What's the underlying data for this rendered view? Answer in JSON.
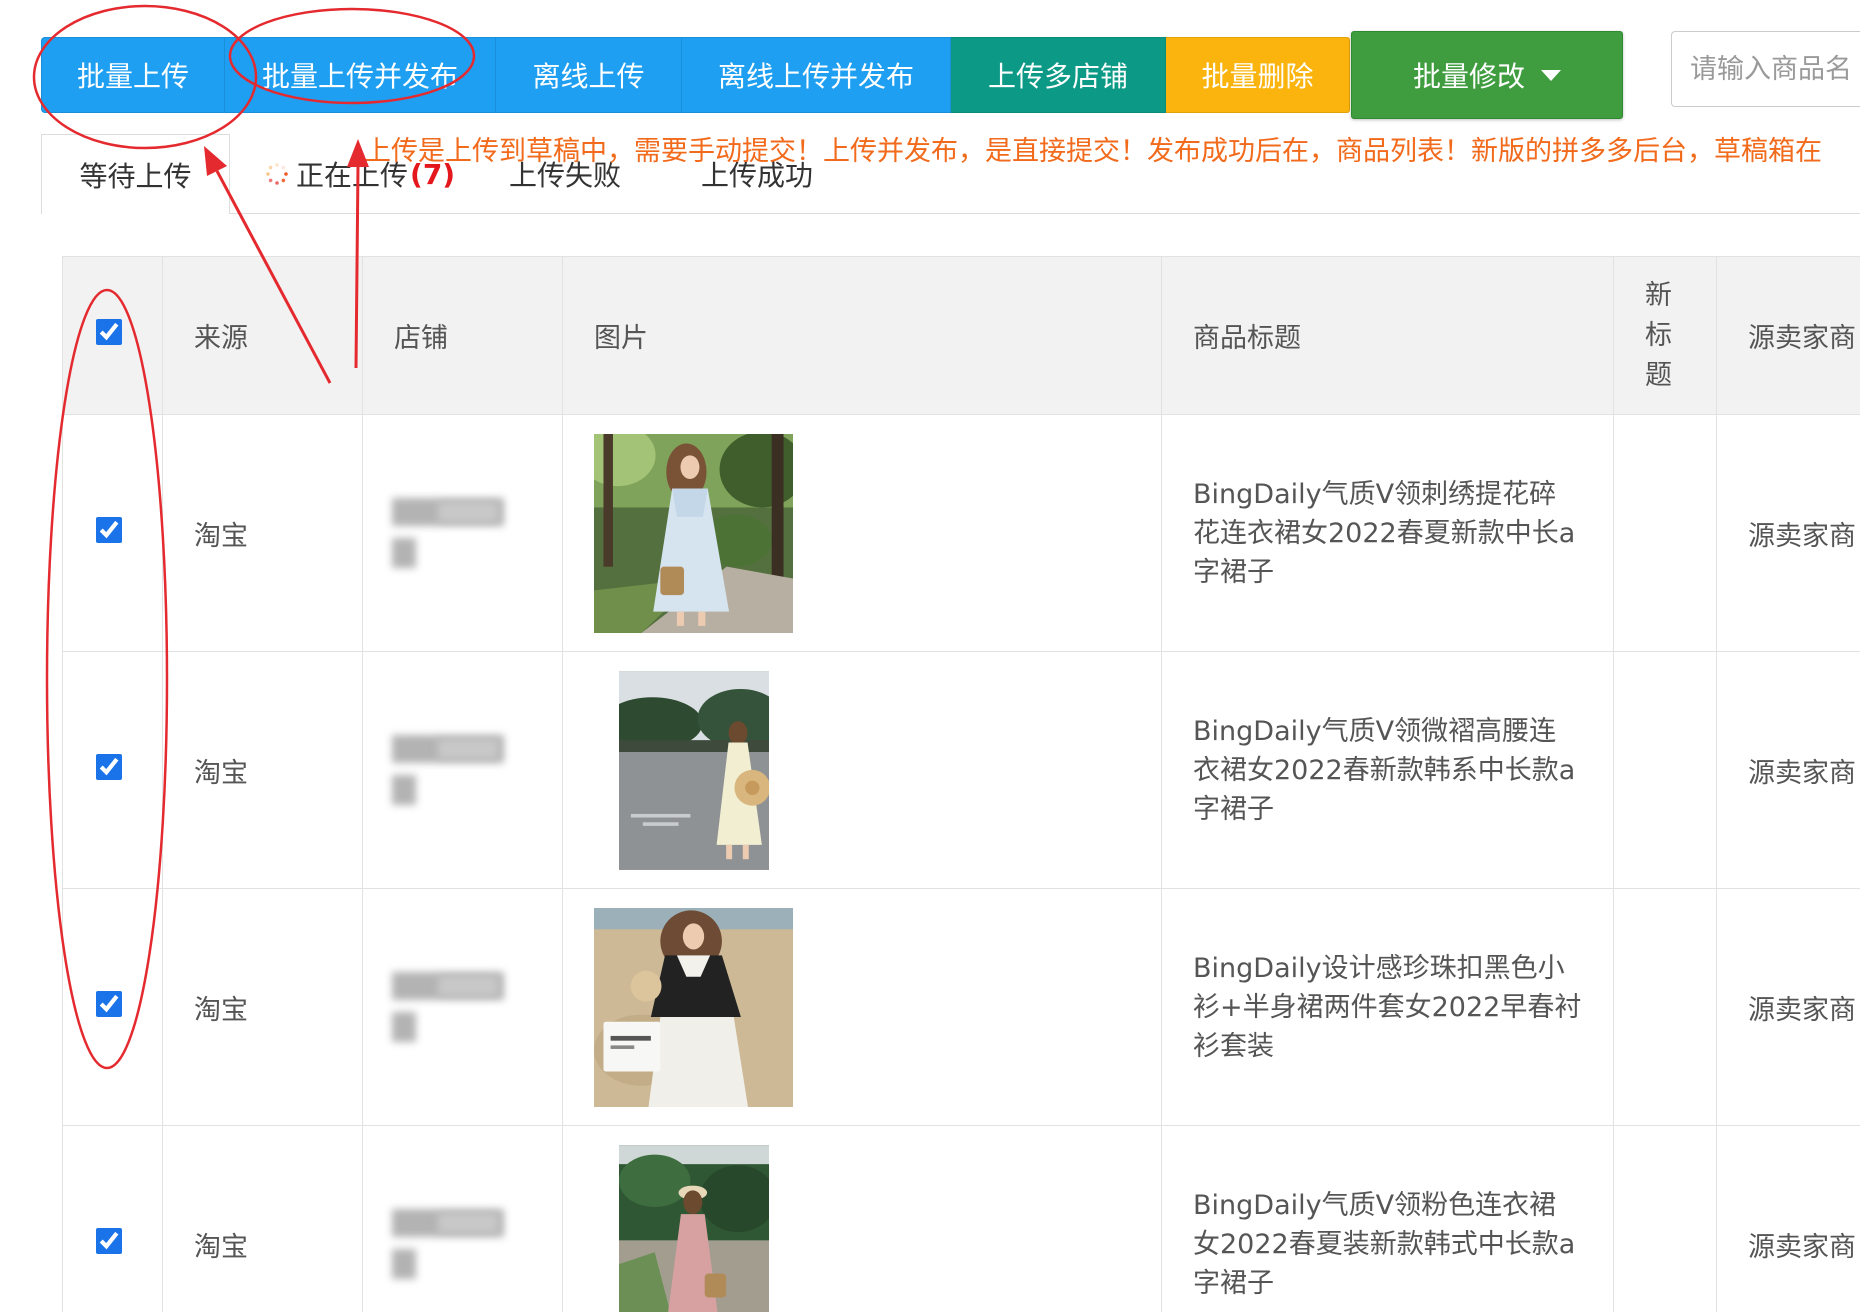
{
  "toolbar": {
    "buttons": [
      {
        "label": "批量上传",
        "color": "#1e9ff2"
      },
      {
        "label": "批量上传并发布",
        "color": "#1e9ff2"
      },
      {
        "label": "离线上传",
        "color": "#1e9ff2"
      },
      {
        "label": "离线上传并发布",
        "color": "#1e9ff2"
      },
      {
        "label": "上传多店铺",
        "color": "#0c9a86"
      },
      {
        "label": "批量删除",
        "color": "#fbb40d"
      }
    ],
    "batch_edit": {
      "label": "批量修改",
      "icon": "caret-down-icon",
      "color": "#3f9d3f"
    },
    "search": {
      "placeholder": "请输入商品名"
    }
  },
  "tabs": [
    {
      "label": "等待上传",
      "active": true
    },
    {
      "label": "正在上传",
      "count": "(7)",
      "icon": "spinner-icon"
    },
    {
      "label": "上传失败"
    },
    {
      "label": "上传成功"
    }
  ],
  "notice": "上传是上传到草稿中，需要手动提交！上传并发布，是直接提交！发布成功后在，商品列表！新版的拼多多后台，草稿箱在",
  "table": {
    "select_all": true,
    "headers": {
      "source": "来源",
      "store": "店铺",
      "image": "图片",
      "title": "商品标题",
      "new_title": "新标题",
      "seller": "源卖家商"
    },
    "rows": [
      {
        "checked": true,
        "source": "淘宝",
        "title": "BingDaily气质V领刺绣提花碎花连衣裙女2022春夏新款中长a字裙子",
        "new_title": "",
        "seller": "源卖家商"
      },
      {
        "checked": true,
        "source": "淘宝",
        "title": "BingDaily气质V领微褶高腰连衣裙女2022春新款韩系中长款a字裙子",
        "new_title": "",
        "seller": "源卖家商"
      },
      {
        "checked": true,
        "source": "淘宝",
        "title": "BingDaily设计感珍珠扣黑色小衫+半身裙两件套女2022早春衬衫套装",
        "new_title": "",
        "seller": "源卖家商"
      },
      {
        "checked": true,
        "source": "淘宝",
        "title": "BingDaily气质V领粉色连衣裙女2022春夏装新款韩式中长款a字裙子",
        "new_title": "",
        "seller": "源卖家商"
      }
    ]
  },
  "colors": {
    "notice": "#f26a1b",
    "count": "#e3171c",
    "annotation": "#e42a2f",
    "checkbox": "#1a73e8",
    "header_bg": "#f2f2f2"
  }
}
